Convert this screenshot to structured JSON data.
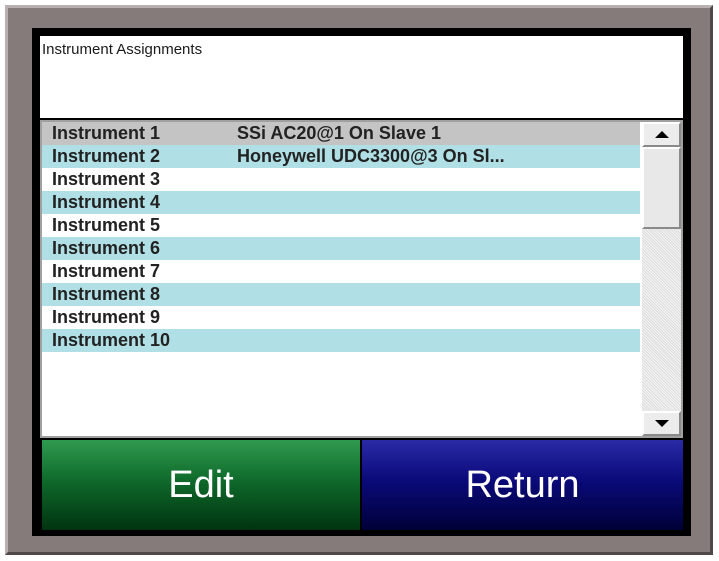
{
  "panel": {
    "title": "Instrument Assignments"
  },
  "instruments": [
    {
      "name": "Instrument 1",
      "assignment": "SSi AC20@1 On Slave 1"
    },
    {
      "name": "Instrument 2",
      "assignment": "Honeywell UDC3300@3 On Sl..."
    },
    {
      "name": "Instrument 3",
      "assignment": ""
    },
    {
      "name": "Instrument 4",
      "assignment": ""
    },
    {
      "name": "Instrument 5",
      "assignment": ""
    },
    {
      "name": "Instrument 6",
      "assignment": ""
    },
    {
      "name": "Instrument 7",
      "assignment": ""
    },
    {
      "name": "Instrument 8",
      "assignment": ""
    },
    {
      "name": "Instrument 9",
      "assignment": ""
    },
    {
      "name": "Instrument 10",
      "assignment": ""
    }
  ],
  "buttons": {
    "edit_label": "Edit",
    "return_label": "Return"
  },
  "colors": {
    "row_alt": "#b0e0e6",
    "row_selected": "#c4c4c4",
    "edit_button": "#0f6a2b",
    "return_button": "#0a0a7a"
  },
  "icons": {
    "scroll_up": "triangle-up",
    "scroll_down": "triangle-down"
  }
}
